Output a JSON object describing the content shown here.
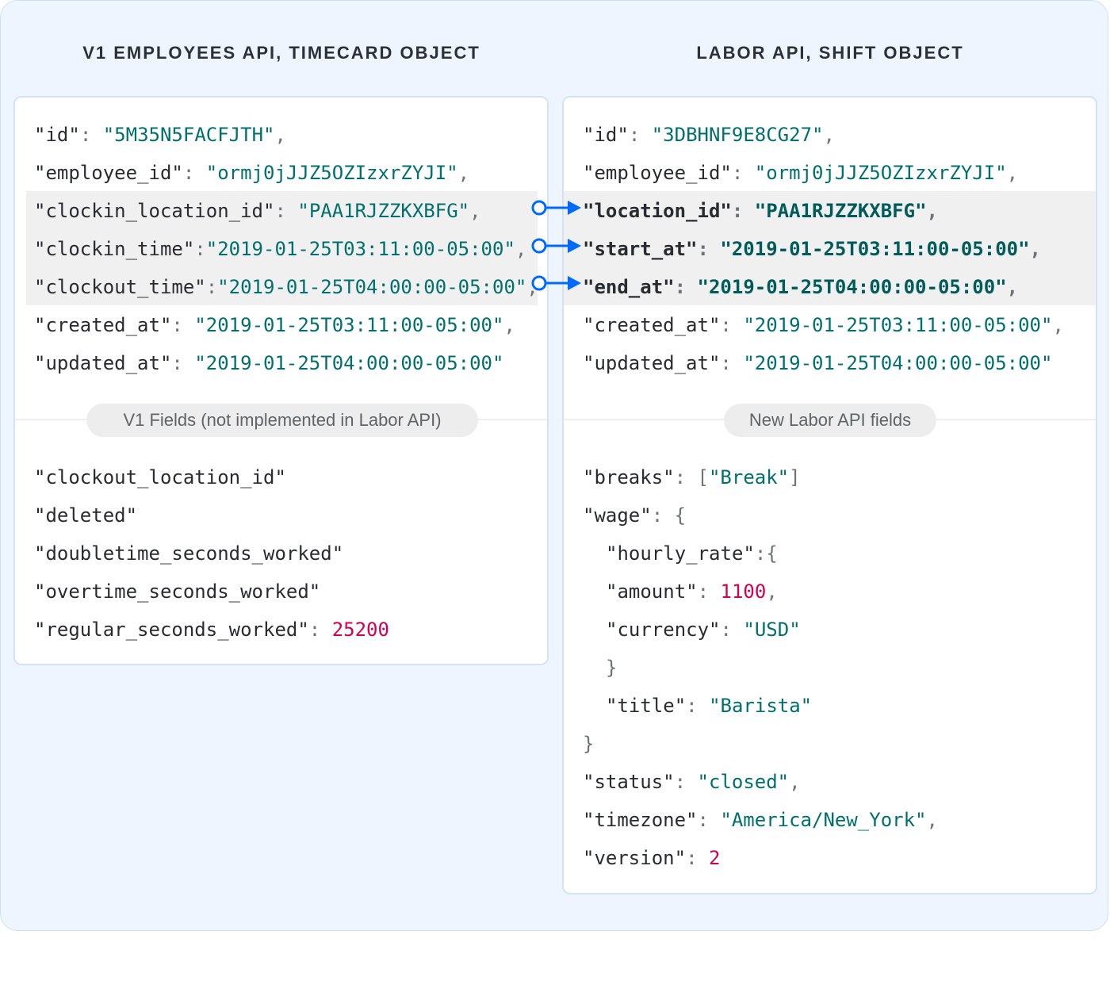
{
  "left": {
    "title": "V1 EMPLOYEES API, TIMECARD OBJECT",
    "fields": [
      {
        "key": "id",
        "value": "5M35N5FACFJTH",
        "trail": ","
      },
      {
        "key": "employee_id",
        "value": "ormj0jJJZ5OZIzxrZYJI",
        "trail": ","
      },
      {
        "key": "clockin_location_id",
        "value": "PAA1RJZZKXBFG",
        "trail": ","
      },
      {
        "key": "clockin_time",
        "value": "2019-01-25T03:11:00-05:00",
        "trail": ","
      },
      {
        "key": "clockout_time",
        "value": "2019-01-25T04:00:00-05:00",
        "trail": ","
      },
      {
        "key": "created_at",
        "value": "2019-01-25T03:11:00-05:00",
        "trail": ","
      },
      {
        "key": "updated_at",
        "value": "2019-01-25T04:00:00-05:00",
        "trail": ""
      }
    ],
    "section_label": "V1 Fields (not implemented in Labor API)",
    "extra_fields": [
      {
        "key": "clockout_location_id"
      },
      {
        "key": "deleted"
      },
      {
        "key": "doubletime_seconds_worked"
      },
      {
        "key": "overtime_seconds_worked"
      },
      {
        "key": "regular_seconds_worked",
        "number": "25200"
      }
    ]
  },
  "right": {
    "title": "LABOR API, SHIFT OBJECT",
    "fields": [
      {
        "key": "id",
        "value": "3DBHNF9E8CG27",
        "trail": ","
      },
      {
        "key": "employee_id",
        "value": "ormj0jJJZ5OZIzxrZYJI",
        "trail": ","
      },
      {
        "key": "location_id",
        "value": "PAA1RJZZKXBFG",
        "trail": ","
      },
      {
        "key": "start_at",
        "value": "2019-01-25T03:11:00-05:00",
        "trail": ","
      },
      {
        "key": "end_at",
        "value": "2019-01-25T04:00:00-05:00",
        "trail": ","
      },
      {
        "key": "created_at",
        "value": "2019-01-25T03:11:00-05:00",
        "trail": ","
      },
      {
        "key": "updated_at",
        "value": "2019-01-25T04:00:00-05:00",
        "trail": ""
      }
    ],
    "section_label": "New Labor API fields",
    "new_fields": {
      "breaks_key": "breaks",
      "breaks_item": "Break",
      "wage_key": "wage",
      "hourly_rate_key": "hourly_rate",
      "amount_key": "amount",
      "amount_value": "1100",
      "currency_key": "currency",
      "currency_value": "USD",
      "title_key": "title",
      "title_value": "Barista",
      "status_key": "status",
      "status_value": "closed",
      "timezone_key": "timezone",
      "timezone_value": "America/New_York",
      "version_key": "version",
      "version_value": "2"
    }
  },
  "colors": {
    "key_text": "#282c30",
    "string_value": "#00706e",
    "number_value": "#d4004f",
    "arrow": "#006aff",
    "highlight": "#f0f0f0"
  }
}
